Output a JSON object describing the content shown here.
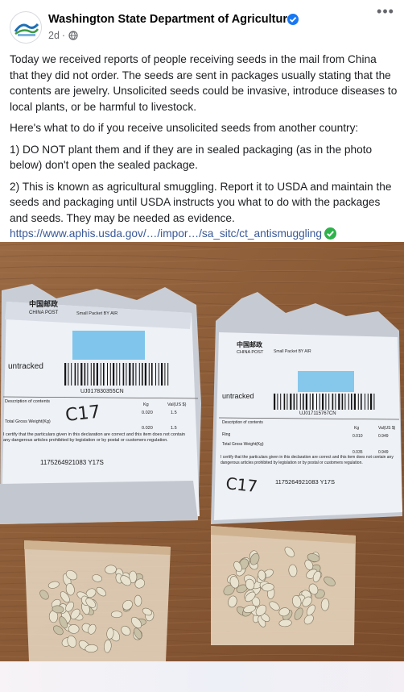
{
  "post": {
    "page_name": "Washington State Department of Agriculture",
    "time": "2d",
    "dot": "·",
    "more_label": "•••",
    "paragraphs": [
      "Today we received reports of people receiving seeds in the mail from China that they did not order. The seeds are sent in packages usually stating that the contents are jewelry. Unsolicited seeds could be invasive, introduce diseases to local plants, or be harmful to livestock.",
      "Here's what to do if you receive unsolicited seeds from another country:",
      "1) DO NOT plant them and if they are in sealed packaging (as in the photo below) don't open the sealed package.",
      "2) This is known as agricultural smuggling. Report it to USDA and maintain the seeds and packaging until USDA instructs you what to do with the packages and seeds. They may be needed as evidence."
    ],
    "link": "https://www.aphis.usda.gov/…/impor…/sa_sitc/ct_antismuggling"
  },
  "photo": {
    "left_label": {
      "brand_cn": "中国邮政",
      "brand_en": "CHINA POST",
      "small_packet": "Small Packet BY AIR",
      "untracked": "untracked",
      "tracking": "UJ017830355CN",
      "contents_hdr": "Description of contents",
      "kg": "Kg",
      "value": "Val(US $)",
      "w1": "0.020",
      "v1": "1.5",
      "w2": "0.020",
      "v2": "1.5",
      "gross": "Total Gross Weight(Kg)",
      "declaration": "I certify that the particulars given in this declaration are correct and this item does not contain any dangerous articles prohibited by legislation or by postal or customers regulation.",
      "sender_no": "1175264921083 Y17S",
      "handwriting": "C17"
    },
    "right_label": {
      "brand_cn": "中国邮政",
      "brand_en": "CHINA POST",
      "small_packet": "Small Packet BY AIR",
      "untracked": "untracked",
      "tracking": "UJ017115767CN",
      "contents_hdr": "Description of contents",
      "kg": "Kg",
      "value": "Val(US $)",
      "item": "Ring",
      "w1": "0.010",
      "v1": "0.949",
      "gross": "Total Gross Weight(Kg)",
      "w2": "0.035",
      "v2": "0.949",
      "declaration": "I certify that the particulars given in this declaration are correct and this item does not contain any dangerous articles prohibited by legislation or by postal or customers regulation.",
      "sender_no": "1175264921083 Y17S",
      "handwriting": "C17"
    }
  },
  "colors": {
    "facebook_blue": "#1877f2",
    "link": "#385898",
    "check_green": "#2fb24c",
    "wood": "#8a5a36"
  }
}
